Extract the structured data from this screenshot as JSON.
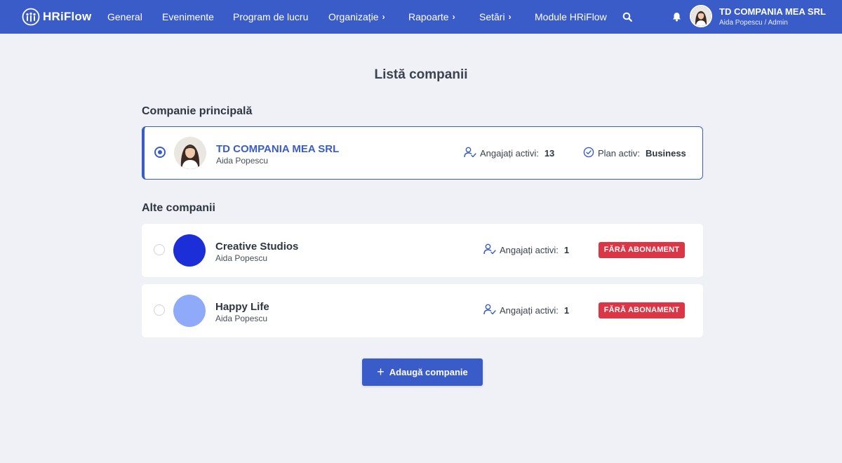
{
  "colors": {
    "brand": "#3a5cc9",
    "badge": "#dc3545",
    "background": "#eff1f6"
  },
  "header": {
    "logo_text": "HRiFlow",
    "nav": [
      {
        "label": "General",
        "has_chevron": false
      },
      {
        "label": "Evenimente",
        "has_chevron": false
      },
      {
        "label": "Program de lucru",
        "has_chevron": false
      },
      {
        "label": "Organizație",
        "has_chevron": true
      },
      {
        "label": "Rapoarte",
        "has_chevron": true
      },
      {
        "label": "Setări",
        "has_chevron": true
      },
      {
        "label": "Module HRiFlow",
        "has_chevron": false
      }
    ],
    "chevron": "›",
    "search_icon": "search-icon",
    "notification_icon": "bell-icon",
    "company_name": "TD COMPANIA MEA SRL",
    "user_role": "Aida Popescu / Admin"
  },
  "main": {
    "title": "Listă companii",
    "primary_section_title": "Companie principală",
    "primary": {
      "name": "TD COMPANIA MEA SRL",
      "owner": "Aida Popescu",
      "employees_label": "Angajați activi:",
      "employees_count": "13",
      "plan_label": "Plan activ:",
      "plan_value": "Business",
      "selected": true
    },
    "other_section_title": "Alte companii",
    "others": [
      {
        "name": "Creative Studios",
        "owner": "Aida Popescu",
        "employees_label": "Angajați activi:",
        "employees_count": "1",
        "badge": "FĂRĂ ABONAMENT",
        "avatar_color": "#1b2ed8"
      },
      {
        "name": "Happy Life",
        "owner": "Aida Popescu",
        "employees_label": "Angajați activi:",
        "employees_count": "1",
        "badge": "FĂRĂ ABONAMENT",
        "avatar_color": "#8eaaf8"
      }
    ],
    "add_button_label": "Adaugă companie"
  }
}
